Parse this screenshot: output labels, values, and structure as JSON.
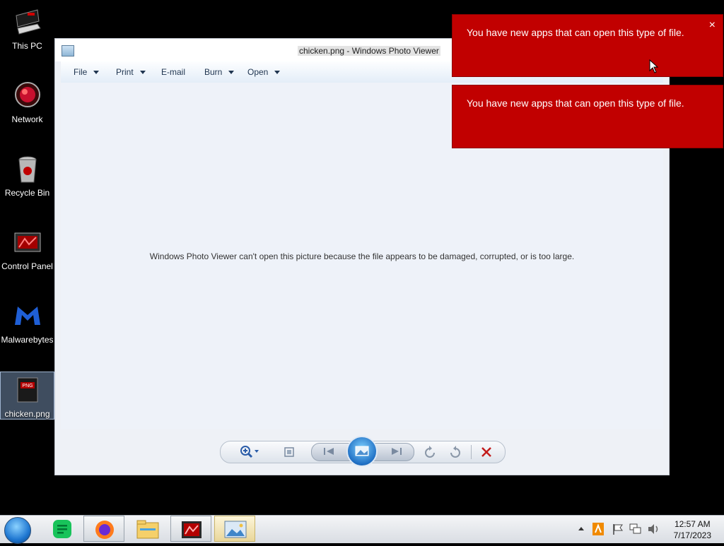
{
  "desktop": {
    "icons": [
      {
        "label": "This PC"
      },
      {
        "label": "Network"
      },
      {
        "label": "Recycle Bin"
      },
      {
        "label": "Control Panel"
      },
      {
        "label": "Malwarebytes"
      },
      {
        "label": "chicken.png",
        "badge": "PNG"
      }
    ]
  },
  "window": {
    "title": "chicken.png - Windows Photo Viewer",
    "menu": [
      {
        "label": "File"
      },
      {
        "label": "Print"
      },
      {
        "label": "E-mail"
      },
      {
        "label": "Burn"
      },
      {
        "label": "Open"
      }
    ],
    "error_message": "Windows Photo Viewer can't open this picture because the file appears to be damaged, corrupted, or is too large."
  },
  "notifications": [
    {
      "message": "You have new apps that can open this type of file.",
      "close": "×"
    },
    {
      "message": "You have new apps that can open this type of file."
    }
  ],
  "taskbar": {
    "clock_time": "12:57 AM",
    "clock_date": "7/17/2023"
  },
  "colors": {
    "toast_bg": "#c10000",
    "desktop_bg": "#000000"
  }
}
